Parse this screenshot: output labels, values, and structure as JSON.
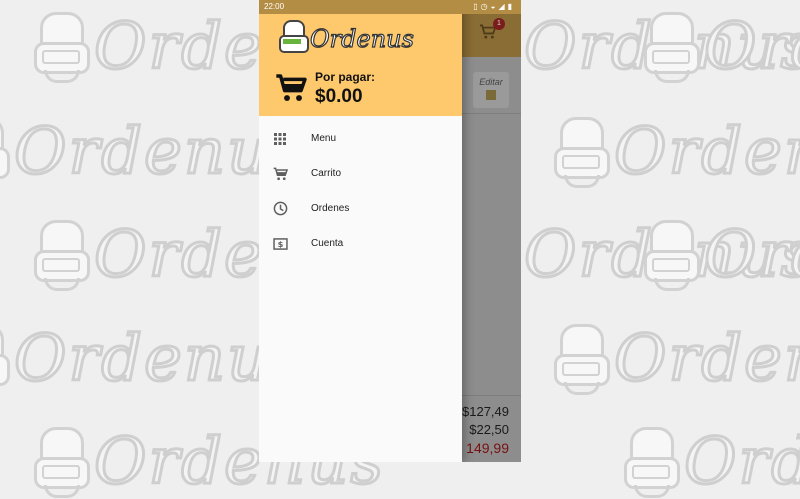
{
  "background": {
    "watermark_text": "Ordenus"
  },
  "status_bar": {
    "time": "22:00"
  },
  "drawer": {
    "brand": "Ordenus",
    "pay_label": "Por pagar:",
    "pay_amount": "$0.00",
    "items": [
      {
        "label": "Menu",
        "icon": "grid-icon"
      },
      {
        "label": "Carrito",
        "icon": "cart-icon"
      },
      {
        "label": "Ordenes",
        "icon": "clock-icon"
      },
      {
        "label": "Cuenta",
        "icon": "dollar-icon"
      }
    ]
  },
  "app": {
    "cart_badge": "1",
    "edit_label": "Editar",
    "totals": [
      "$127,49",
      "$22,50",
      "149,99"
    ]
  },
  "colors": {
    "header": "#fec86c",
    "status_bar": "#b38d43",
    "drawer_bg": "#fafafa",
    "total_red": "#7a1010"
  }
}
